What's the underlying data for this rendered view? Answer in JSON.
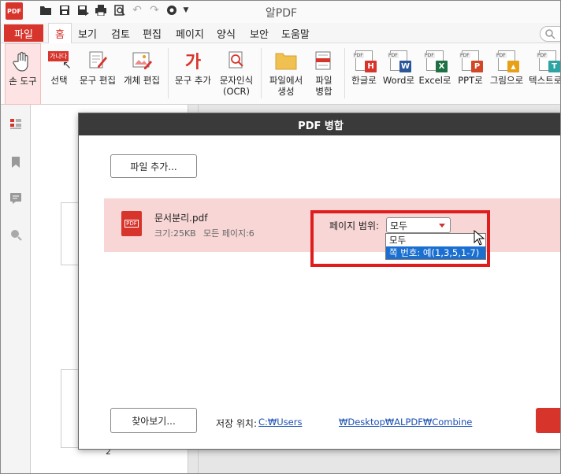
{
  "app": {
    "logo_text": "PDF",
    "title": "알PDF"
  },
  "menu": {
    "file": "파일",
    "home": "홈",
    "items": [
      "보기",
      "검토",
      "편집",
      "페이지",
      "양식",
      "보안",
      "도움말"
    ]
  },
  "ribbon": {
    "hand_tool": "손 도구",
    "select": "선택",
    "select_icon_text": "가나다",
    "text_edit": "문구 편집",
    "object_edit": "개체 편집",
    "add_text": "문구 추가",
    "add_text_icon": "가",
    "ocr": "문자인식\n(OCR)",
    "create_from_file": "파일에서\n생성",
    "merge_files": "파일\n병합",
    "to_hangul": "한글로",
    "to_word": "Word로",
    "to_excel": "Excel로",
    "to_ppt": "PPT로",
    "to_image": "그림으로",
    "to_text": "텍스트로",
    "badges": {
      "hangul": "H",
      "word": "W",
      "excel": "X",
      "ppt": "P",
      "image": "▲",
      "text": "T"
    },
    "badge_colors": {
      "hangul": "#d7352c",
      "word": "#2b579a",
      "excel": "#1e7145",
      "ppt": "#d24726",
      "image": "#e6a117",
      "text": "#2fa3a3"
    }
  },
  "sidebar": {
    "page_number": "2"
  },
  "dialog": {
    "title": "PDF 병합",
    "add_file_button": "파일 추가...",
    "file": {
      "icon_text": "PDF",
      "name": "문서분리.pdf",
      "size": "크기:25KB",
      "pages": "모든 페이지:6"
    },
    "page_range": {
      "label": "페이지 범위:",
      "selected": "모두",
      "options": [
        "모두",
        "쪽 번호: 예(1,3,5,1-7)"
      ],
      "highlighted_index": 1
    },
    "browse_button": "찾아보기...",
    "save_location_label": "저장 위치:",
    "save_path_part1": "C:₩Users",
    "save_path_part2": "₩Desktop₩ALPDF₩Combine"
  },
  "colors": {
    "accent": "#d7352c",
    "highlight": "#e01d1d",
    "selection": "#1a6fd1"
  }
}
